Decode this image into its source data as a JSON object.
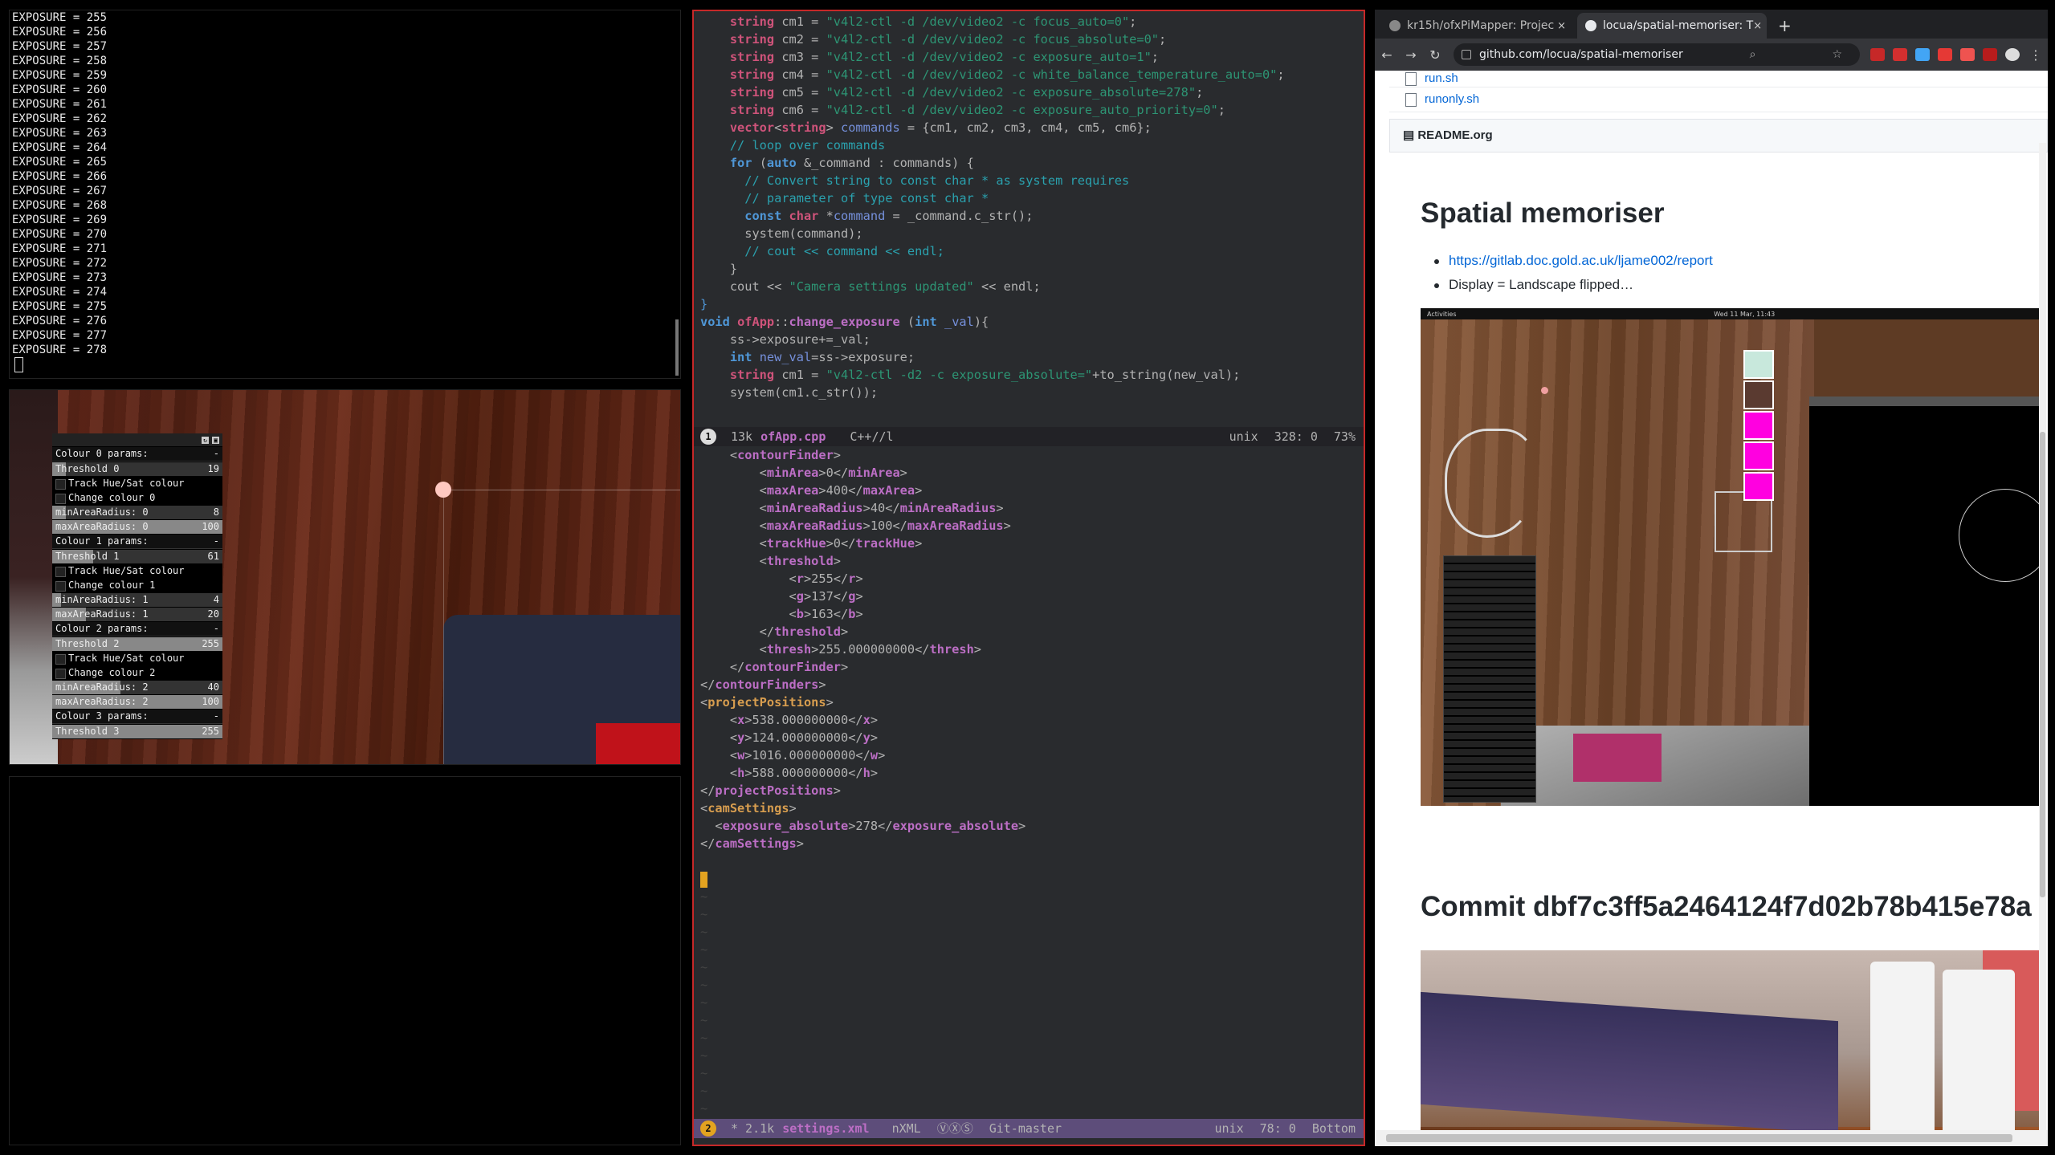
{
  "terminal": {
    "lines": [
      "EXPOSURE = 255",
      "EXPOSURE = 256",
      "EXPOSURE = 257",
      "EXPOSURE = 258",
      "EXPOSURE = 259",
      "EXPOSURE = 260",
      "EXPOSURE = 261",
      "EXPOSURE = 262",
      "EXPOSURE = 263",
      "EXPOSURE = 264",
      "EXPOSURE = 265",
      "EXPOSURE = 266",
      "EXPOSURE = 267",
      "EXPOSURE = 268",
      "EXPOSURE = 269",
      "EXPOSURE = 270",
      "EXPOSURE = 271",
      "EXPOSURE = 272",
      "EXPOSURE = 273",
      "EXPOSURE = 274",
      "EXPOSURE = 275",
      "EXPOSURE = 276",
      "EXPOSURE = 277",
      "EXPOSURE = 278"
    ]
  },
  "gui": {
    "groups": [
      {
        "title": "Colour 0 params:",
        "collapse": "-",
        "threshold": "Threshold 0",
        "threshold_val": "19",
        "threshold_frac": 0.08,
        "track": "Track Hue/Sat colour",
        "change": "Change colour 0",
        "min": "minAreaRadius: 0",
        "min_val": "8",
        "min_frac": 0.08,
        "max": "maxAreaRadius: 0",
        "max_val": "100",
        "max_frac": 1.0
      },
      {
        "title": "Colour 1 params:",
        "collapse": "-",
        "threshold": "Threshold 1",
        "threshold_val": "61",
        "threshold_frac": 0.24,
        "track": "Track Hue/Sat colour",
        "change": "Change colour 1",
        "min": "minAreaRadius: 1",
        "min_val": "4",
        "min_frac": 0.04,
        "max": "maxAreaRadius: 1",
        "max_val": "20",
        "max_frac": 0.2
      },
      {
        "title": "Colour 2 params:",
        "collapse": "-",
        "threshold": "Threshold 2",
        "threshold_val": "255",
        "threshold_frac": 1.0,
        "track": "Track Hue/Sat colour",
        "change": "Change colour 2",
        "min": "minAreaRadius: 2",
        "min_val": "40",
        "min_frac": 0.4,
        "max": "maxAreaRadius: 2",
        "max_val": "100",
        "max_frac": 1.0
      },
      {
        "title": "Colour 3 params:",
        "collapse": "-",
        "threshold": "Threshold 3",
        "threshold_val": "255",
        "threshold_frac": 1.0
      }
    ]
  },
  "editor": {
    "top_lines": [
      [
        [
          "    ",
          "tx"
        ],
        [
          "string",
          "ty"
        ],
        [
          " cm1 = ",
          "tx"
        ],
        [
          "\"v4l2-ctl -d /dev/video2 -c focus_auto=0\"",
          "str"
        ],
        [
          ";",
          "tx"
        ]
      ],
      [
        [
          "    ",
          "tx"
        ],
        [
          "string",
          "ty"
        ],
        [
          " cm2 = ",
          "tx"
        ],
        [
          "\"v4l2-ctl -d /dev/video2 -c focus_absolute=0\"",
          "str"
        ],
        [
          ";",
          "tx"
        ]
      ],
      [
        [
          "    ",
          "tx"
        ],
        [
          "string",
          "ty"
        ],
        [
          " cm3 = ",
          "tx"
        ],
        [
          "\"v4l2-ctl -d /dev/video2 -c exposure_auto=1\"",
          "str"
        ],
        [
          ";",
          "tx"
        ]
      ],
      [
        [
          "    ",
          "tx"
        ],
        [
          "string",
          "ty"
        ],
        [
          " cm4 = ",
          "tx"
        ],
        [
          "\"v4l2-ctl -d /dev/video2 -c white_balance_temperature_auto=0\"",
          "str"
        ],
        [
          ";",
          "tx"
        ]
      ],
      [
        [
          "    ",
          "tx"
        ],
        [
          "string",
          "ty"
        ],
        [
          " cm5 = ",
          "tx"
        ],
        [
          "\"v4l2-ctl -d /dev/video2 -c exposure_absolute=278\"",
          "str"
        ],
        [
          ";",
          "tx"
        ]
      ],
      [
        [
          "    ",
          "tx"
        ],
        [
          "string",
          "ty"
        ],
        [
          " cm6 = ",
          "tx"
        ],
        [
          "\"v4l2-ctl -d /dev/video2 -c exposure_auto_priority=0\"",
          "str"
        ],
        [
          ";",
          "tx"
        ]
      ],
      [
        [
          "    ",
          "tx"
        ],
        [
          "vector",
          "ty"
        ],
        [
          "<",
          "tx"
        ],
        [
          "string",
          "ty"
        ],
        [
          "> ",
          "tx"
        ],
        [
          "commands",
          "var"
        ],
        [
          " = {cm1, cm2, cm3, cm4, cm5, cm6};",
          "tx"
        ]
      ],
      [
        [
          "    ",
          "tx"
        ],
        [
          "// loop over commands",
          "cm"
        ]
      ],
      [
        [
          "    ",
          "tx"
        ],
        [
          "for",
          "kw"
        ],
        [
          " (",
          "tx"
        ],
        [
          "auto",
          "kw"
        ],
        [
          " &_command : commands) {",
          "tx"
        ]
      ],
      [
        [
          "      ",
          "tx"
        ],
        [
          "// Convert string to const char * as system requires",
          "cm"
        ]
      ],
      [
        [
          "      ",
          "tx"
        ],
        [
          "// parameter of type const char *",
          "cm"
        ]
      ],
      [
        [
          "      ",
          "tx"
        ],
        [
          "const",
          "kw"
        ],
        [
          " ",
          "tx"
        ],
        [
          "char",
          "ty"
        ],
        [
          " *",
          "tx"
        ],
        [
          "command",
          "var"
        ],
        [
          " = _command.c_str();",
          "tx"
        ]
      ],
      [
        [
          "      ",
          "tx"
        ],
        [
          "system(command);",
          "tx"
        ]
      ],
      [
        [
          "      ",
          "tx"
        ],
        [
          "// cout << command << endl;",
          "cm"
        ]
      ],
      [
        [
          "    }",
          "tx"
        ]
      ],
      [
        [
          "    cout << ",
          "tx"
        ],
        [
          "\"Camera settings updated\"",
          "str"
        ],
        [
          " << endl;",
          "tx"
        ]
      ],
      [
        [
          "}",
          "br"
        ]
      ],
      [
        [
          "",
          "tx"
        ]
      ],
      [
        [
          "void",
          "kw"
        ],
        [
          " ",
          "tx"
        ],
        [
          "ofApp",
          "ty"
        ],
        [
          "::",
          "tx"
        ],
        [
          "change_exposure",
          "fn"
        ],
        [
          " (",
          "tx"
        ],
        [
          "int",
          "kw"
        ],
        [
          " ",
          "tx"
        ],
        [
          "_val",
          "var"
        ],
        [
          "){",
          "tx"
        ]
      ],
      [
        [
          "    ss->exposure+=_val;",
          "tx"
        ]
      ],
      [
        [
          "    ",
          "tx"
        ],
        [
          "int",
          "kw"
        ],
        [
          " ",
          "tx"
        ],
        [
          "new_val",
          "var"
        ],
        [
          "=ss->exposure;",
          "tx"
        ]
      ],
      [
        [
          "    ",
          "tx"
        ],
        [
          "string",
          "ty"
        ],
        [
          " cm1 = ",
          "tx"
        ],
        [
          "\"v4l2-ctl -d2 -c exposure_absolute=\"",
          "str"
        ],
        [
          "+to_string(new_val);",
          "tx"
        ]
      ],
      [
        [
          "    system(cm1.c_str());",
          "tx"
        ]
      ]
    ],
    "top_modeline": {
      "num": "1",
      "size": "13k",
      "file": "ofApp.cpp",
      "mode": "C++//l",
      "enc": "unix",
      "pos": "328: 0",
      "pct": "73%"
    },
    "bottom_lines": [
      [
        [
          "    <",
          "tx"
        ],
        [
          "contourFinder",
          "tag"
        ],
        [
          ">",
          "tx"
        ]
      ],
      [
        [
          "        <",
          "tx"
        ],
        [
          "minArea",
          "tag"
        ],
        [
          ">0</",
          "tx"
        ],
        [
          "minArea",
          "tag"
        ],
        [
          ">",
          "tx"
        ]
      ],
      [
        [
          "        <",
          "tx"
        ],
        [
          "maxArea",
          "tag"
        ],
        [
          ">400</",
          "tx"
        ],
        [
          "maxArea",
          "tag"
        ],
        [
          ">",
          "tx"
        ]
      ],
      [
        [
          "        <",
          "tx"
        ],
        [
          "minAreaRadius",
          "tag"
        ],
        [
          ">40</",
          "tx"
        ],
        [
          "minAreaRadius",
          "tag"
        ],
        [
          ">",
          "tx"
        ]
      ],
      [
        [
          "        <",
          "tx"
        ],
        [
          "maxAreaRadius",
          "tag"
        ],
        [
          ">100</",
          "tx"
        ],
        [
          "maxAreaRadius",
          "tag"
        ],
        [
          ">",
          "tx"
        ]
      ],
      [
        [
          "        <",
          "tx"
        ],
        [
          "trackHue",
          "tag"
        ],
        [
          ">0</",
          "tx"
        ],
        [
          "trackHue",
          "tag"
        ],
        [
          ">",
          "tx"
        ]
      ],
      [
        [
          "        <",
          "tx"
        ],
        [
          "threshold",
          "tag"
        ],
        [
          ">",
          "tx"
        ]
      ],
      [
        [
          "            <",
          "tx"
        ],
        [
          "r",
          "tag"
        ],
        [
          ">255</",
          "tx"
        ],
        [
          "r",
          "tag"
        ],
        [
          ">",
          "tx"
        ]
      ],
      [
        [
          "            <",
          "tx"
        ],
        [
          "g",
          "tag"
        ],
        [
          ">137</",
          "tx"
        ],
        [
          "g",
          "tag"
        ],
        [
          ">",
          "tx"
        ]
      ],
      [
        [
          "            <",
          "tx"
        ],
        [
          "b",
          "tag"
        ],
        [
          ">163</",
          "tx"
        ],
        [
          "b",
          "tag"
        ],
        [
          ">",
          "tx"
        ]
      ],
      [
        [
          "        </",
          "tx"
        ],
        [
          "threshold",
          "tag"
        ],
        [
          ">",
          "tx"
        ]
      ],
      [
        [
          "        <",
          "tx"
        ],
        [
          "thresh",
          "tag"
        ],
        [
          ">255.000000000</",
          "tx"
        ],
        [
          "thresh",
          "tag"
        ],
        [
          ">",
          "tx"
        ]
      ],
      [
        [
          "    </",
          "tx"
        ],
        [
          "contourFinder",
          "tag"
        ],
        [
          ">",
          "tx"
        ]
      ],
      [
        [
          "</",
          "tx"
        ],
        [
          "contourFinders",
          "tag"
        ],
        [
          ">",
          "tx"
        ]
      ],
      [
        [
          "<",
          "tx"
        ],
        [
          "projectPositions",
          "hl"
        ],
        [
          ">",
          "tx"
        ]
      ],
      [
        [
          "    <",
          "tx"
        ],
        [
          "x",
          "tag"
        ],
        [
          ">538.000000000</",
          "tx"
        ],
        [
          "x",
          "tag"
        ],
        [
          ">",
          "tx"
        ]
      ],
      [
        [
          "    <",
          "tx"
        ],
        [
          "y",
          "tag"
        ],
        [
          ">124.000000000</",
          "tx"
        ],
        [
          "y",
          "tag"
        ],
        [
          ">",
          "tx"
        ]
      ],
      [
        [
          "    <",
          "tx"
        ],
        [
          "w",
          "tag"
        ],
        [
          ">1016.000000000</",
          "tx"
        ],
        [
          "w",
          "tag"
        ],
        [
          ">",
          "tx"
        ]
      ],
      [
        [
          "    <",
          "tx"
        ],
        [
          "h",
          "tag"
        ],
        [
          ">588.000000000</",
          "tx"
        ],
        [
          "h",
          "tag"
        ],
        [
          ">",
          "tx"
        ]
      ],
      [
        [
          "</",
          "tx"
        ],
        [
          "projectPositions",
          "tag"
        ],
        [
          ">",
          "tx"
        ]
      ],
      [
        [
          "<",
          "tx"
        ],
        [
          "camSettings",
          "hl"
        ],
        [
          ">",
          "tx"
        ]
      ],
      [
        [
          "  <",
          "tx"
        ],
        [
          "exposure_absolute",
          "tag"
        ],
        [
          ">278</",
          "tx"
        ],
        [
          "exposure_absolute",
          "tag"
        ],
        [
          ">",
          "tx"
        ]
      ],
      [
        [
          "</",
          "tx"
        ],
        [
          "camSettings",
          "tag"
        ],
        [
          ">",
          "tx"
        ]
      ]
    ],
    "tilde_count": 13,
    "bottom_modeline": {
      "num": "2",
      "size": "* 2.1k",
      "file": "settings.xml",
      "mode": "nXML",
      "icons": "ⓋⓍⓈ",
      "branch": "Git-master",
      "enc": "unix",
      "pos": "78: 0",
      "pct": "Bottom"
    }
  },
  "browser": {
    "tabs": [
      {
        "title": "kr15h/ofxPiMapper: Projec",
        "close": "×"
      },
      {
        "title": "locua/spatial-memoriser: T",
        "close": "×"
      }
    ],
    "new_tab": "+",
    "url": "github.com/locua/spatial-memoriser",
    "back": "←",
    "forward": "→",
    "reload": "↻",
    "files": [
      "run.sh",
      "runonly.sh"
    ],
    "readme_label": "README.org",
    "readme_title": "Spatial memoriser",
    "link": "https://gitlab.doc.gold.ac.uk/ljame002/report",
    "bullet2": "Display = Landscape flipped…",
    "shot_topbar_left": "Activities",
    "shot_topbar_clock": "Wed 11 Mar, 11:43",
    "commit_title": "Commit dbf7c3ff5a2464124f7d02b78b415e78a",
    "colors": {
      "squares": [
        "#c8e8dc",
        "#5a3a30",
        "#ff00e0",
        "#ff00e0",
        "#ff00e0"
      ]
    }
  }
}
